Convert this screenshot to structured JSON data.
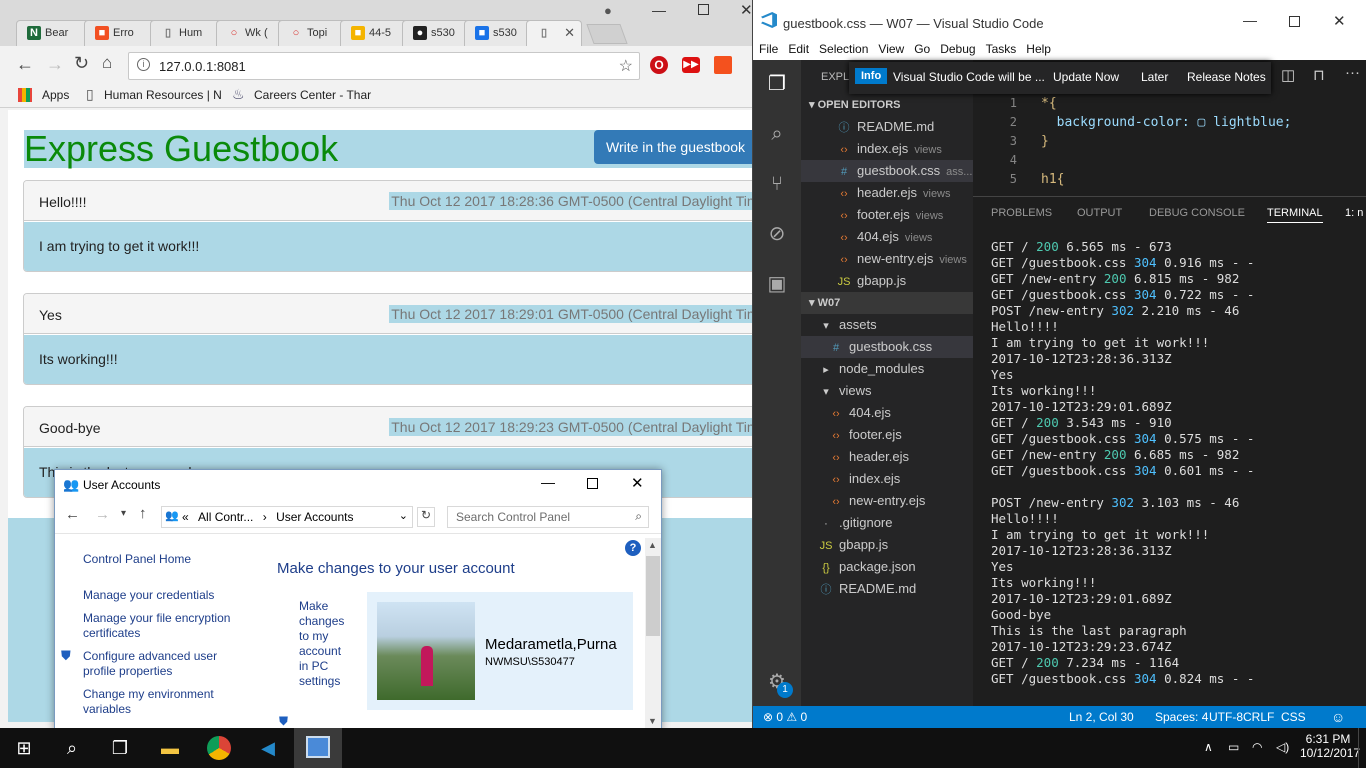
{
  "chrome": {
    "tabs": [
      {
        "label": "Bear",
        "icon": "N",
        "color": "#1f6b3b"
      },
      {
        "label": "Erro",
        "icon": "■",
        "color": "#f25022"
      },
      {
        "label": "Hum",
        "icon": "▯",
        "color": "#777777"
      },
      {
        "label": "Wk (",
        "icon": "○",
        "color": "#d9302c"
      },
      {
        "label": "Topi",
        "icon": "○",
        "color": "#d9302c"
      },
      {
        "label": "44-5",
        "icon": "■",
        "color": "#f4b400"
      },
      {
        "label": "s530",
        "icon": "●",
        "color": "#222222"
      },
      {
        "label": "s530",
        "icon": "■",
        "color": "#1a73e8"
      },
      {
        "label": "",
        "icon": "▯",
        "color": "#777777"
      }
    ],
    "url": "127.0.0.1:8081",
    "bookmarks": [
      "Apps",
      "Human Resources | N",
      "Careers Center - Thar"
    ]
  },
  "guestbook": {
    "title": "Express Guestbook",
    "write_button": "Write in the guestbook",
    "entries": [
      {
        "title": "Hello!!!!",
        "date": "Thu Oct 12 2017 18:28:36 GMT-0500 (Central Daylight Time)",
        "content": "I am trying to get it work!!!"
      },
      {
        "title": "Yes",
        "date": "Thu Oct 12 2017 18:29:01 GMT-0500 (Central Daylight Time)",
        "content": "Its working!!!"
      },
      {
        "title": "Good-bye",
        "date": "Thu Oct 12 2017 18:29:23 GMT-0500 (Central Daylight Time)",
        "content": "This is the last paragraph"
      }
    ]
  },
  "vscode": {
    "title": "guestbook.css — W07 — Visual Studio Code",
    "menu": [
      "File",
      "Edit",
      "Selection",
      "View",
      "Go",
      "Debug",
      "Tasks",
      "Help"
    ],
    "notification": {
      "badge": "Info",
      "message": "Visual Studio Code will be ...",
      "update": "Update Now",
      "later": "Later",
      "notes": "Release Notes"
    },
    "explorer_label": "EXPL",
    "open_editors_label": "OPEN EDITORS",
    "open_editors": [
      {
        "name": "README.md",
        "hint": "",
        "icon": "ⓘ"
      },
      {
        "name": "index.ejs",
        "hint": "views",
        "icon": "‹›"
      },
      {
        "name": "guestbook.css",
        "hint": "ass...",
        "icon": "#"
      },
      {
        "name": "header.ejs",
        "hint": "views",
        "icon": "‹›"
      },
      {
        "name": "footer.ejs",
        "hint": "views",
        "icon": "‹›"
      },
      {
        "name": "404.ejs",
        "hint": "views",
        "icon": "‹›"
      },
      {
        "name": "new-entry.ejs",
        "hint": "views",
        "icon": "‹›"
      },
      {
        "name": "gbapp.js",
        "hint": "",
        "icon": "JS"
      }
    ],
    "folder_label": "W07",
    "tree": [
      {
        "name": "assets",
        "icon": "▾",
        "indent": 1
      },
      {
        "name": "guestbook.css",
        "icon": "#",
        "indent": 2
      },
      {
        "name": "node_modules",
        "icon": "▸",
        "indent": 1
      },
      {
        "name": "views",
        "icon": "▾",
        "indent": 1
      },
      {
        "name": "404.ejs",
        "icon": "‹›",
        "indent": 2
      },
      {
        "name": "footer.ejs",
        "icon": "‹›",
        "indent": 2
      },
      {
        "name": "header.ejs",
        "icon": "‹›",
        "indent": 2
      },
      {
        "name": "index.ejs",
        "icon": "‹›",
        "indent": 2
      },
      {
        "name": "new-entry.ejs",
        "icon": "‹›",
        "indent": 2
      },
      {
        "name": ".gitignore",
        "icon": "·",
        "indent": 1
      },
      {
        "name": "gbapp.js",
        "icon": "JS",
        "indent": 1
      },
      {
        "name": "package.json",
        "icon": "{}",
        "indent": 1
      },
      {
        "name": "README.md",
        "icon": "ⓘ",
        "indent": 1
      }
    ],
    "code": [
      {
        "n": "1",
        "text": "*{"
      },
      {
        "n": "2",
        "text": "  background-color: ▢ lightblue;"
      },
      {
        "n": "3",
        "text": "}"
      },
      {
        "n": "4",
        "text": ""
      },
      {
        "n": "5",
        "text": "h1{"
      }
    ],
    "panel_tabs": [
      "PROBLEMS",
      "OUTPUT",
      "DEBUG CONSOLE",
      "TERMINAL",
      "1: n"
    ],
    "terminal": [
      "GET / 200 6.565 ms - 673",
      "GET /guestbook.css 304 0.916 ms - -",
      "GET /new-entry 200 6.815 ms - 982",
      "GET /guestbook.css 304 0.722 ms - -",
      "POST /new-entry 302 2.210 ms - 46",
      "Hello!!!!",
      "I am trying to get it work!!!",
      "2017-10-12T23:28:36.313Z",
      "Yes",
      "Its working!!!",
      "2017-10-12T23:29:01.689Z",
      "GET / 200 3.543 ms - 910",
      "GET /guestbook.css 304 0.575 ms - -",
      "GET /new-entry 200 6.685 ms - 982",
      "GET /guestbook.css 304 0.601 ms - -",
      "",
      "POST /new-entry 302 3.103 ms - 46",
      "Hello!!!!",
      "I am trying to get it work!!!",
      "2017-10-12T23:28:36.313Z",
      "Yes",
      "Its working!!!",
      "2017-10-12T23:29:01.689Z",
      "Good-bye",
      "This is the last paragraph",
      "2017-10-12T23:29:23.674Z",
      "GET / 200 7.234 ms - 1164",
      "GET /guestbook.css 304 0.824 ms - -"
    ],
    "status": {
      "errors": "0",
      "warnings": "0",
      "position": "Ln 2, Col 30",
      "spaces": "Spaces: 4",
      "encoding": "UTF-8",
      "eol": "CRLF",
      "language": "CSS"
    },
    "settings_badge": "1"
  },
  "user_accounts": {
    "title": "User Accounts",
    "crumb_prefix": "«",
    "crumb_parent": "All Contr...",
    "crumb_current": "User Accounts",
    "search_placeholder": "Search Control Panel",
    "home_link": "Control Panel Home",
    "links": [
      "Manage your credentials",
      "Manage your file encryption certificates",
      "Configure advanced user profile properties",
      "Change my environment variables"
    ],
    "heading": "Make changes to your user account",
    "pc_settings_link": "Make changes to my account in PC settings",
    "user_name": "Medarametla,Purna",
    "user_domain": "NWMSU\\S530477"
  },
  "taskbar": {
    "time": "6:31 PM",
    "date": "10/12/2017"
  }
}
